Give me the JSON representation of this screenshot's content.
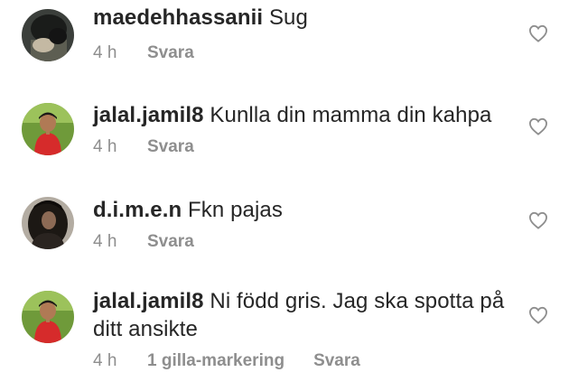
{
  "comments": [
    {
      "username": "maedehhassanii",
      "text": "Sug",
      "age": "4 h",
      "likes": "",
      "reply": "Svara",
      "avatar_icon": "avatar-dark-photo",
      "like_icon": "heart-outline-icon"
    },
    {
      "username": "jalal.jamil8",
      "text": "Kunlla din mamma din kahpa",
      "age": "4 h",
      "likes": "",
      "reply": "Svara",
      "avatar_icon": "avatar-red-shirt-photo",
      "like_icon": "heart-outline-icon"
    },
    {
      "username": "d.i.m.e.n",
      "text": "Fkn pajas",
      "age": "4 h",
      "likes": "",
      "reply": "Svara",
      "avatar_icon": "avatar-dark-hair-photo",
      "like_icon": "heart-outline-icon"
    },
    {
      "username": "jalal.jamil8",
      "text": "Ni född gris. Jag ska spotta på ditt ansikte",
      "age": "4 h",
      "likes": "1 gilla-markering",
      "reply": "Svara",
      "avatar_icon": "avatar-red-shirt-photo",
      "like_icon": "heart-outline-icon"
    }
  ],
  "colors": {
    "text": "#262626",
    "meta": "#8e8e8e",
    "heart": "#8e8e8e"
  }
}
